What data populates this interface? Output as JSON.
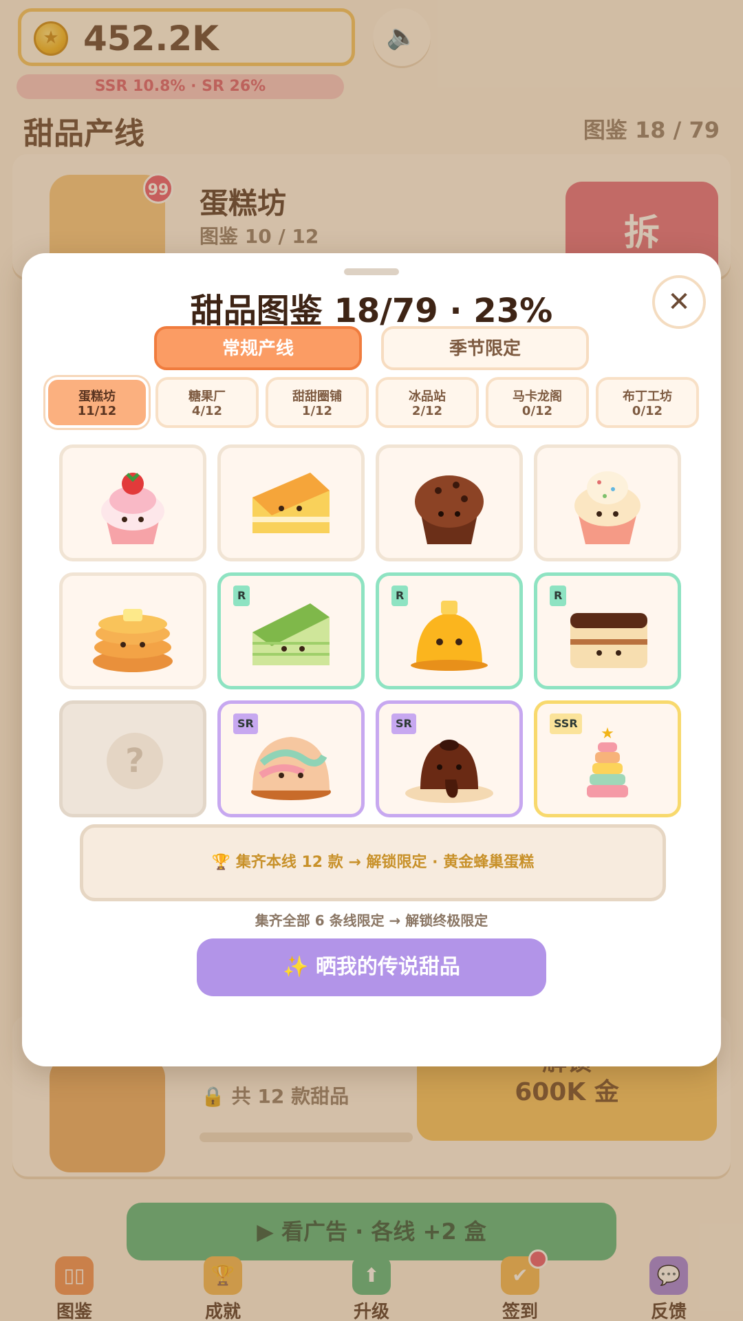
{
  "header": {
    "coins": "452.2K",
    "rates": "SSR 10.8% · SR 26%"
  },
  "section": {
    "title": "甜品产线",
    "collection": "图鉴 18 / 79"
  },
  "line_card_1": {
    "name": "蛋糕坊",
    "collection": "图鉴 10 / 12",
    "badge": "99",
    "action": "拆"
  },
  "line_card_2": {
    "lock_text": "共 12 款甜品",
    "unlock_line1": "解锁",
    "unlock_line2": "600K 金"
  },
  "ad_button": "看广告 · 各线 +2 盒",
  "bottom_nav": [
    {
      "label": "图鉴",
      "color": "#f08a4b"
    },
    {
      "label": "成就",
      "color": "#f3b64a"
    },
    {
      "label": "升级",
      "color": "#4fb47b"
    },
    {
      "label": "签到",
      "color": "#f3b64a"
    },
    {
      "label": "反馈",
      "color": "#9b7be0"
    }
  ],
  "modal": {
    "title": "甜品图鉴 18/79 · 23%",
    "tabs": [
      "常规产线",
      "季节限定"
    ],
    "lines": [
      {
        "name": "蛋糕坊",
        "count": "11/12"
      },
      {
        "name": "糖果厂",
        "count": "4/12"
      },
      {
        "name": "甜甜圈铺",
        "count": "1/12"
      },
      {
        "name": "冰品站",
        "count": "2/12"
      },
      {
        "name": "马卡龙阁",
        "count": "0/12"
      },
      {
        "name": "布丁工坊",
        "count": "0/12"
      }
    ],
    "grid": [
      {
        "rarity": "",
        "sweet": "strawberry-cupcake-icon"
      },
      {
        "rarity": "",
        "sweet": "cake-slice-icon"
      },
      {
        "rarity": "",
        "sweet": "chocolate-muffin-icon"
      },
      {
        "rarity": "",
        "sweet": "sprinkle-cupcake-icon"
      },
      {
        "rarity": "",
        "sweet": "pancake-stack-icon"
      },
      {
        "rarity": "R",
        "sweet": "matcha-crepe-cake-icon"
      },
      {
        "rarity": "R",
        "sweet": "custard-pudding-icon"
      },
      {
        "rarity": "R",
        "sweet": "tiramisu-icon"
      },
      {
        "rarity": "?",
        "sweet": "locked-icon"
      },
      {
        "rarity": "SR",
        "sweet": "rainbow-bun-icon"
      },
      {
        "rarity": "SR",
        "sweet": "lava-cake-icon"
      },
      {
        "rarity": "SSR",
        "sweet": "tiered-rainbow-cake-icon"
      }
    ],
    "reward": "🏆 集齐本线 12 款 → 解锁限定 · 黄金蜂巢蛋糕",
    "final_note": "集齐全部 6 条线限定 → 解锁终极限定",
    "share": "✨ 晒我的传说甜品",
    "close": "✕",
    "locked_mark": "?"
  }
}
